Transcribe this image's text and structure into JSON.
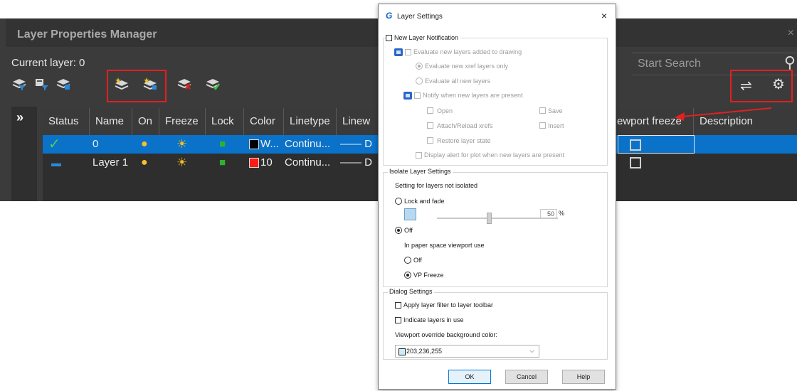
{
  "lpm": {
    "title": "Layer Properties Manager",
    "close_glyph": "×",
    "current_layer": "Current layer: 0",
    "search_placeholder": "Start Search",
    "toolbar_icons": [
      "layer-filter-icon",
      "layer-properties-filter-icon",
      "layer-group-filter-icon",
      "new-layer-icon",
      "new-layer-vp-frozen-icon",
      "delete-layer-icon",
      "set-current-layer-icon"
    ],
    "right_icons": [
      "refresh-icon",
      "settings-icon"
    ],
    "expand_glyph": "»",
    "columns": [
      "Status",
      "Name",
      "On",
      "Freeze",
      "Lock",
      "Color",
      "Linetype",
      "Linew",
      "ewport freeze",
      "Description"
    ],
    "rows": [
      {
        "name": "0",
        "color_label": "W...",
        "color_hex": "#000000",
        "linetype": "Continu...",
        "lineweight": "—— D",
        "selected": true
      },
      {
        "name": "Layer 1",
        "color_label": "10",
        "color_hex": "#ff1a1a",
        "linetype": "Continu...",
        "lineweight": "—— D",
        "selected": false
      }
    ],
    "highlight_color": "#e32020"
  },
  "dialog": {
    "title": "Layer Settings",
    "close_glyph": "×",
    "new_layer_notification": {
      "label": "New Layer Notification",
      "evaluate_added": "Evaluate new layers added to drawing",
      "eval_xref_only": "Evaluate new xref layers only",
      "eval_all": "Evaluate all new layers",
      "notify_present": "Notify when new layers are present",
      "open": "Open",
      "save": "Save",
      "attach_reload": "Attach/Reload xrefs",
      "insert": "Insert",
      "restore_state": "Restore layer state",
      "display_alert": "Display alert for plot when new layers are present"
    },
    "isolate": {
      "group_label": "Isolate Layer Settings",
      "setting_label": "Setting for layers not isolated",
      "lock_and_fade": "Lock and fade",
      "fade_value": "50",
      "percent": "%",
      "off": "Off",
      "paper_space_label": "In paper space viewport use",
      "ps_off": "Off",
      "vp_freeze": "VP Freeze"
    },
    "dialog_settings": {
      "group_label": "Dialog Settings",
      "apply_filter": "Apply layer filter to layer toolbar",
      "indicate_in_use": "Indicate layers in use",
      "override_bg_label": "Viewport override background color:",
      "override_bg_value": "203,236,255",
      "dropdown_glyph": "⌵"
    },
    "buttons": {
      "ok": "OK",
      "cancel": "Cancel",
      "help": "Help"
    }
  }
}
